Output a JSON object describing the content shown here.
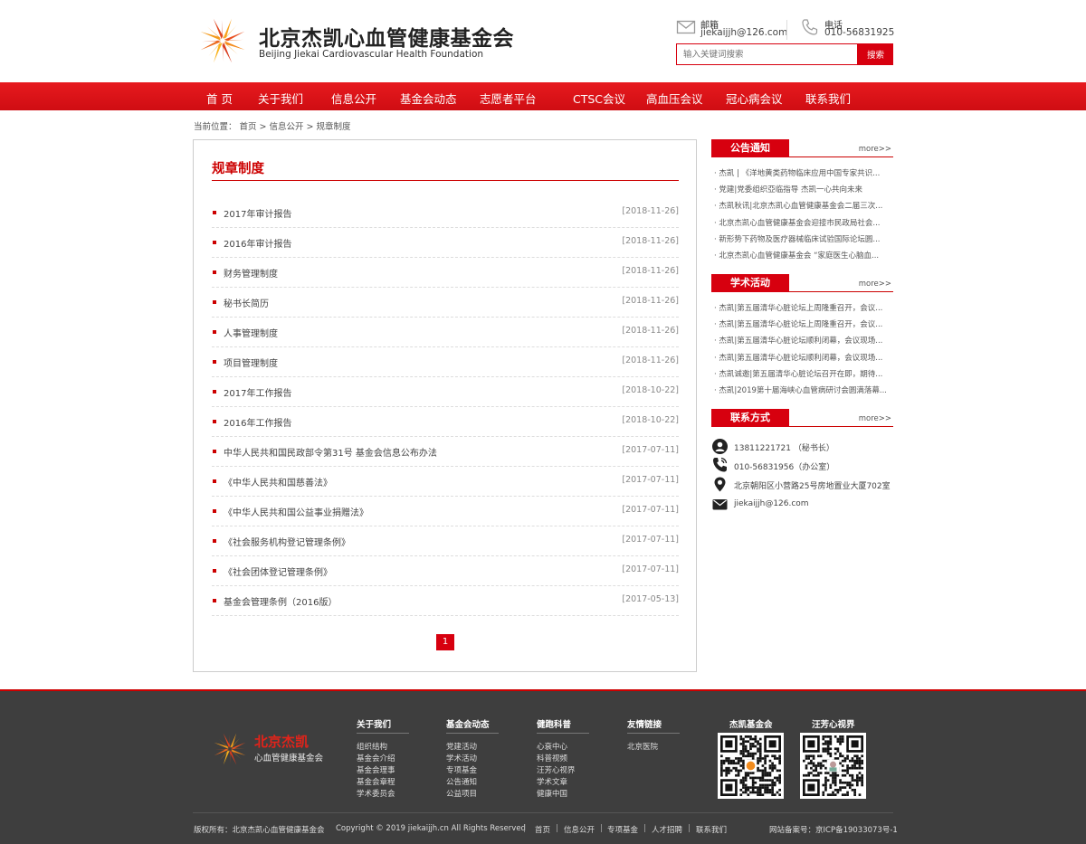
{
  "header": {
    "site_name": "北京杰凯心血管健康基金会",
    "site_name_en": "Beijing Jiekai Cardiovascular Health Foundation",
    "email_label": "邮箱",
    "email_value": "jiekaijjh@126.com",
    "phone_label": "电话",
    "phone_value": "010-56831925",
    "search_placeholder": "输入关键词搜索",
    "search_button": "搜索"
  },
  "nav": [
    "首 页",
    "关于我们",
    "信息公开",
    "基金会动态",
    "志愿者平台",
    "CTSC会议",
    "高血压会议",
    "冠心病会议",
    "联系我们"
  ],
  "breadcrumb": "当前位置： 首页 > 信息公开 > 规章制度",
  "main": {
    "title": "规章制度",
    "items": [
      {
        "title": "2017年审计报告",
        "date": "[2018-11-26]"
      },
      {
        "title": "2016年审计报告",
        "date": "[2018-11-26]"
      },
      {
        "title": "财务管理制度",
        "date": "[2018-11-26]"
      },
      {
        "title": "秘书长简历",
        "date": "[2018-11-26]"
      },
      {
        "title": "人事管理制度",
        "date": "[2018-11-26]"
      },
      {
        "title": "项目管理制度",
        "date": "[2018-11-26]"
      },
      {
        "title": "2017年工作报告",
        "date": "[2018-10-22]"
      },
      {
        "title": "2016年工作报告",
        "date": "[2018-10-22]"
      },
      {
        "title": "中华人民共和国民政部令第31号 基金会信息公布办法",
        "date": "[2017-07-11]"
      },
      {
        "title": "《中华人民共和国慈善法》",
        "date": "[2017-07-11]"
      },
      {
        "title": "《中华人民共和国公益事业捐赠法》",
        "date": "[2017-07-11]"
      },
      {
        "title": "《社会服务机构登记管理条例》",
        "date": "[2017-07-11]"
      },
      {
        "title": "《社会团体登记管理条例》",
        "date": "[2017-07-11]"
      },
      {
        "title": "基金会管理条例（2016版）",
        "date": "[2017-05-13]"
      }
    ],
    "page": "1"
  },
  "sidebar": {
    "notices": {
      "title": "公告通知",
      "more": "more>>",
      "items": [
        "· 杰凯 | 《洋地黄类药物临床应用中国专家共识...",
        "· 党建|党委组织亞临指导 杰凯一心共向未来",
        "· 杰凯秋讯|北京杰凯心血管健康基金会二届三次...",
        "· 北京杰凯心血管健康基金会迎接市民政局社会...",
        "· 新形势下药物及医疗器械临床试验国际论坛圆...",
        "· 北京杰凯心血管健康基金会 “家庭医生心脑血..."
      ]
    },
    "academic": {
      "title": "学术活动",
      "more": "more>>",
      "items": [
        "· 杰凯|第五届清华心脏论坛上周隆重召开，会议...",
        "· 杰凯|第五届清华心脏论坛上周隆重召开，会议...",
        "· 杰凯|第五届清华心脏论坛顺利闭幕，会议现场...",
        "· 杰凯|第五届清华心脏论坛顺利闭幕，会议现场...",
        "· 杰凯诚邀|第五届清华心脏论坛召开在即，期待...",
        "· 杰凯|2019第十届海峡心血管病研讨会圆满落幕..."
      ]
    },
    "contact": {
      "title": "联系方式",
      "more": "more>>",
      "mobile": "13811221721 （秘书长）",
      "tel": "010-56831956（办公室）",
      "address": "北京朝阳区小营路25号房地置业大厦702室",
      "email": "jiekaijjh@126.com"
    }
  },
  "footer": {
    "name": "北京杰凯",
    "sub": "心血管健康基金会",
    "cols": [
      {
        "title": "关于我们",
        "items": [
          "组织结构",
          "基金会介绍",
          "基金会理事",
          "基金会章程",
          "学术委员会"
        ]
      },
      {
        "title": "基金会动态",
        "items": [
          "党建活动",
          "学术活动",
          "专项基金",
          "公告通知",
          "公益项目"
        ]
      },
      {
        "title": "健跑科普",
        "items": [
          "心衰中心",
          "科普视频",
          "汪芳心视界",
          "学术文章",
          "健康中国"
        ]
      },
      {
        "title": "友情链接",
        "items": [
          "北京医院"
        ]
      }
    ],
    "qr1_title": "杰凯基金会",
    "qr2_title": "汪芳心视界",
    "copyright_owner": "版权所有：北京杰凯心血管健康基金会",
    "copyright": "Copyright © 2019 jiekaijjh.cn All Rights Reserved",
    "links": [
      "首页",
      "信息公开",
      "专项基金",
      "人才招聘",
      "联系我们"
    ],
    "icp": "网站备案号：京ICP备19033073号-1"
  }
}
